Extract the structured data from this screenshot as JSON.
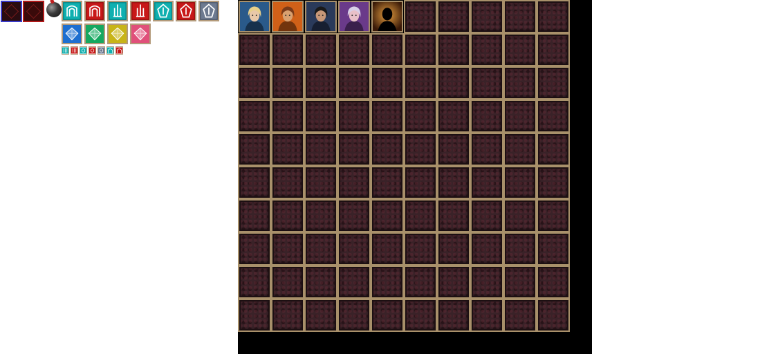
{
  "colors": {
    "cell_bg": "#3a2228",
    "cell_border": "#a8906a",
    "panel_bg": "#000000",
    "frame_blue": "#3a3ac8",
    "frame_red": "#b01818"
  },
  "top_icons": [
    {
      "name": "blue-frame-slot-icon"
    },
    {
      "name": "red-frame-slot-icon"
    },
    {
      "name": "bomb-icon"
    }
  ],
  "rune_row_1": [
    {
      "name": "cyan-arch-rune-icon",
      "color": "#0fb0b0"
    },
    {
      "name": "red-arch-rune-icon",
      "color": "#c81818"
    },
    {
      "name": "cyan-tower-rune-icon",
      "color": "#0fb0b0"
    },
    {
      "name": "red-tower-rune-icon",
      "color": "#c81818"
    },
    {
      "name": "cyan-helm-rune-icon",
      "color": "#0fb0b0"
    },
    {
      "name": "red-helm-rune-icon",
      "color": "#c81818"
    },
    {
      "name": "steel-helm-rune-icon",
      "color": "#6d7a90"
    }
  ],
  "gem_row": [
    {
      "name": "blue-gem-icon",
      "color": "#1e6fd0"
    },
    {
      "name": "green-gem-icon",
      "color": "#15a860"
    },
    {
      "name": "gold-gem-icon",
      "color": "#c8b418"
    },
    {
      "name": "pink-gem-icon",
      "color": "#e0507a"
    }
  ],
  "mini_icons": [
    {
      "name": "mini-cyan-fork-icon",
      "color": "#0fb0b0"
    },
    {
      "name": "mini-red-fork-icon",
      "color": "#c81818"
    },
    {
      "name": "mini-cyan-burst-icon",
      "color": "#0fb0b0"
    },
    {
      "name": "mini-red-burst-icon",
      "color": "#c81818"
    },
    {
      "name": "mini-steel-burst-icon",
      "color": "#6d7a90"
    },
    {
      "name": "mini-cyan-arch-icon",
      "color": "#0fb0b0"
    },
    {
      "name": "mini-red-arch-icon",
      "color": "#c81818"
    }
  ],
  "grid": {
    "rows": 10,
    "cols": 10,
    "portraits": [
      {
        "name": "blonde-mage-portrait",
        "hair": "#e8d08a",
        "bg": "#2a5a8a",
        "skin": "#e8c8a8"
      },
      {
        "name": "fire-warrior-portrait",
        "hair": "#7a3a18",
        "bg": "#d06018",
        "skin": "#d8a070"
      },
      {
        "name": "dark-knight-portrait",
        "hair": "#1a1a1a",
        "bg": "#2a3a5a",
        "skin": "#c89878"
      },
      {
        "name": "silver-hair-rogue-portrait",
        "hair": "#d8d0e8",
        "bg": "#6a3a8a",
        "skin": "#e8c0c8"
      },
      {
        "name": "silhouette-portrait",
        "hair": "#000000",
        "bg": "#8a5a20",
        "skin": "#000000"
      }
    ]
  }
}
